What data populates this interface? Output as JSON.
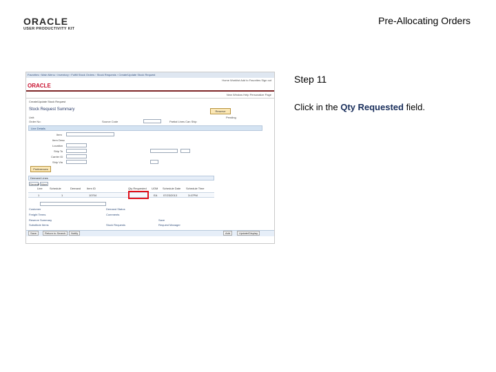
{
  "header": {
    "logo_word": "ORACLE",
    "logo_sub": "USER PRODUCTIVITY KIT",
    "page_title": "Pre-Allocating Orders"
  },
  "step": {
    "title": "Step 11",
    "instruction_prefix": "Click in the ",
    "instruction_field": "Qty Requested",
    "instruction_suffix": " field."
  },
  "screenshot": {
    "top_nav": "Favorites  ›  Main Menu  ›  Inventory  ›  Fulfill Stock Orders  ›  Stock Requests  ›  Create/Update Stock Request",
    "brand": "ORACLE",
    "brand_links": "Home   Worklist   Add to Favorites   Sign out",
    "bar_links": "New Window   Help   Personalize Page",
    "crumb": "Create/Update Stock Request",
    "heading": "Stock Request Summary",
    "buttons": {
      "reserve": "Reserve",
      "preferences": "Preferences",
      "add": "Add",
      "update_display": "Update/Display"
    },
    "labels": {
      "unit": "Unit:",
      "order_no": "Order No:",
      "line_details": "Line Details",
      "item": "Item",
      "item_desc": "Item Desc",
      "location": "Location",
      "ship_to": "Ship To",
      "carrier_id": "Carrier ID",
      "ship_via": "Ship Via",
      "demand_lines": "Demand Lines",
      "hdr_status": "Pending",
      "partial_lines": "Partial Lines Can Ship",
      "source_code": "Source Code",
      "col_line": "Line",
      "col_schedule": "Schedule",
      "col_demand": "Demand",
      "col_item": "Item ID",
      "col_qty": "Qty Requested",
      "col_uom": "UOM",
      "col_sched_date": "Schedule Date",
      "col_sched_time": "Schedule Time",
      "more_label": "Line More",
      "tab_general": "General",
      "tab_more": "More"
    },
    "links": {
      "l1": "Customer",
      "l2": "Freight Terms",
      "l3": "Reserve Summary",
      "l4": "Substitute Items",
      "l5": "Comments",
      "l6": "Stock Requests",
      "l7": "Demand Status",
      "l8": "Save",
      "l9": "Request Manager"
    },
    "row": {
      "line": "1",
      "schedule": "1",
      "demand": "",
      "item": "10704",
      "uom": "EA",
      "date": "07/23/2013",
      "time": "3:47PM"
    },
    "footer": {
      "save": "Save",
      "return": "Return to Search",
      "notify": "Notify",
      "add": "Add",
      "update": "Update/Display"
    }
  }
}
